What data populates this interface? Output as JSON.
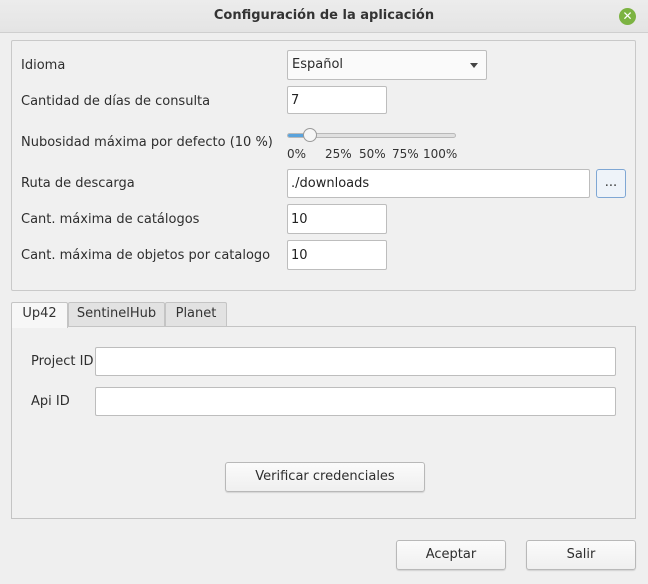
{
  "window": {
    "title": "Configuración de la aplicación"
  },
  "general": {
    "language_label": "Idioma",
    "language_value": "Español",
    "days_label": "Cantidad de días de consulta",
    "days_value": "7",
    "cloud_label": "Nubosidad máxima por defecto (10 %)",
    "cloud_slider_percent": 10,
    "cloud_ticks": [
      "0%",
      "25%",
      "50%",
      "75%",
      "100%"
    ],
    "download_path_label": "Ruta de descarga",
    "download_path_value": "./downloads",
    "browse_label": "...",
    "max_catalogs_label": "Cant. máxima de catálogos",
    "max_catalogs_value": "10",
    "max_objects_label": "Cant. máxima de objetos por catalogo",
    "max_objects_value": "10"
  },
  "tabs": [
    {
      "label": "Up42",
      "active": true
    },
    {
      "label": "SentinelHub",
      "active": false
    },
    {
      "label": "Planet",
      "active": false
    }
  ],
  "up42": {
    "project_id_label": "Project ID",
    "project_id_value": "",
    "api_id_label": "Api ID",
    "api_id_value": "",
    "verify_label": "Verificar credenciales"
  },
  "footer": {
    "accept_label": "Aceptar",
    "exit_label": "Salir"
  },
  "colors": {
    "accent": "#5aa3dc",
    "close_button": "#7cb342"
  }
}
